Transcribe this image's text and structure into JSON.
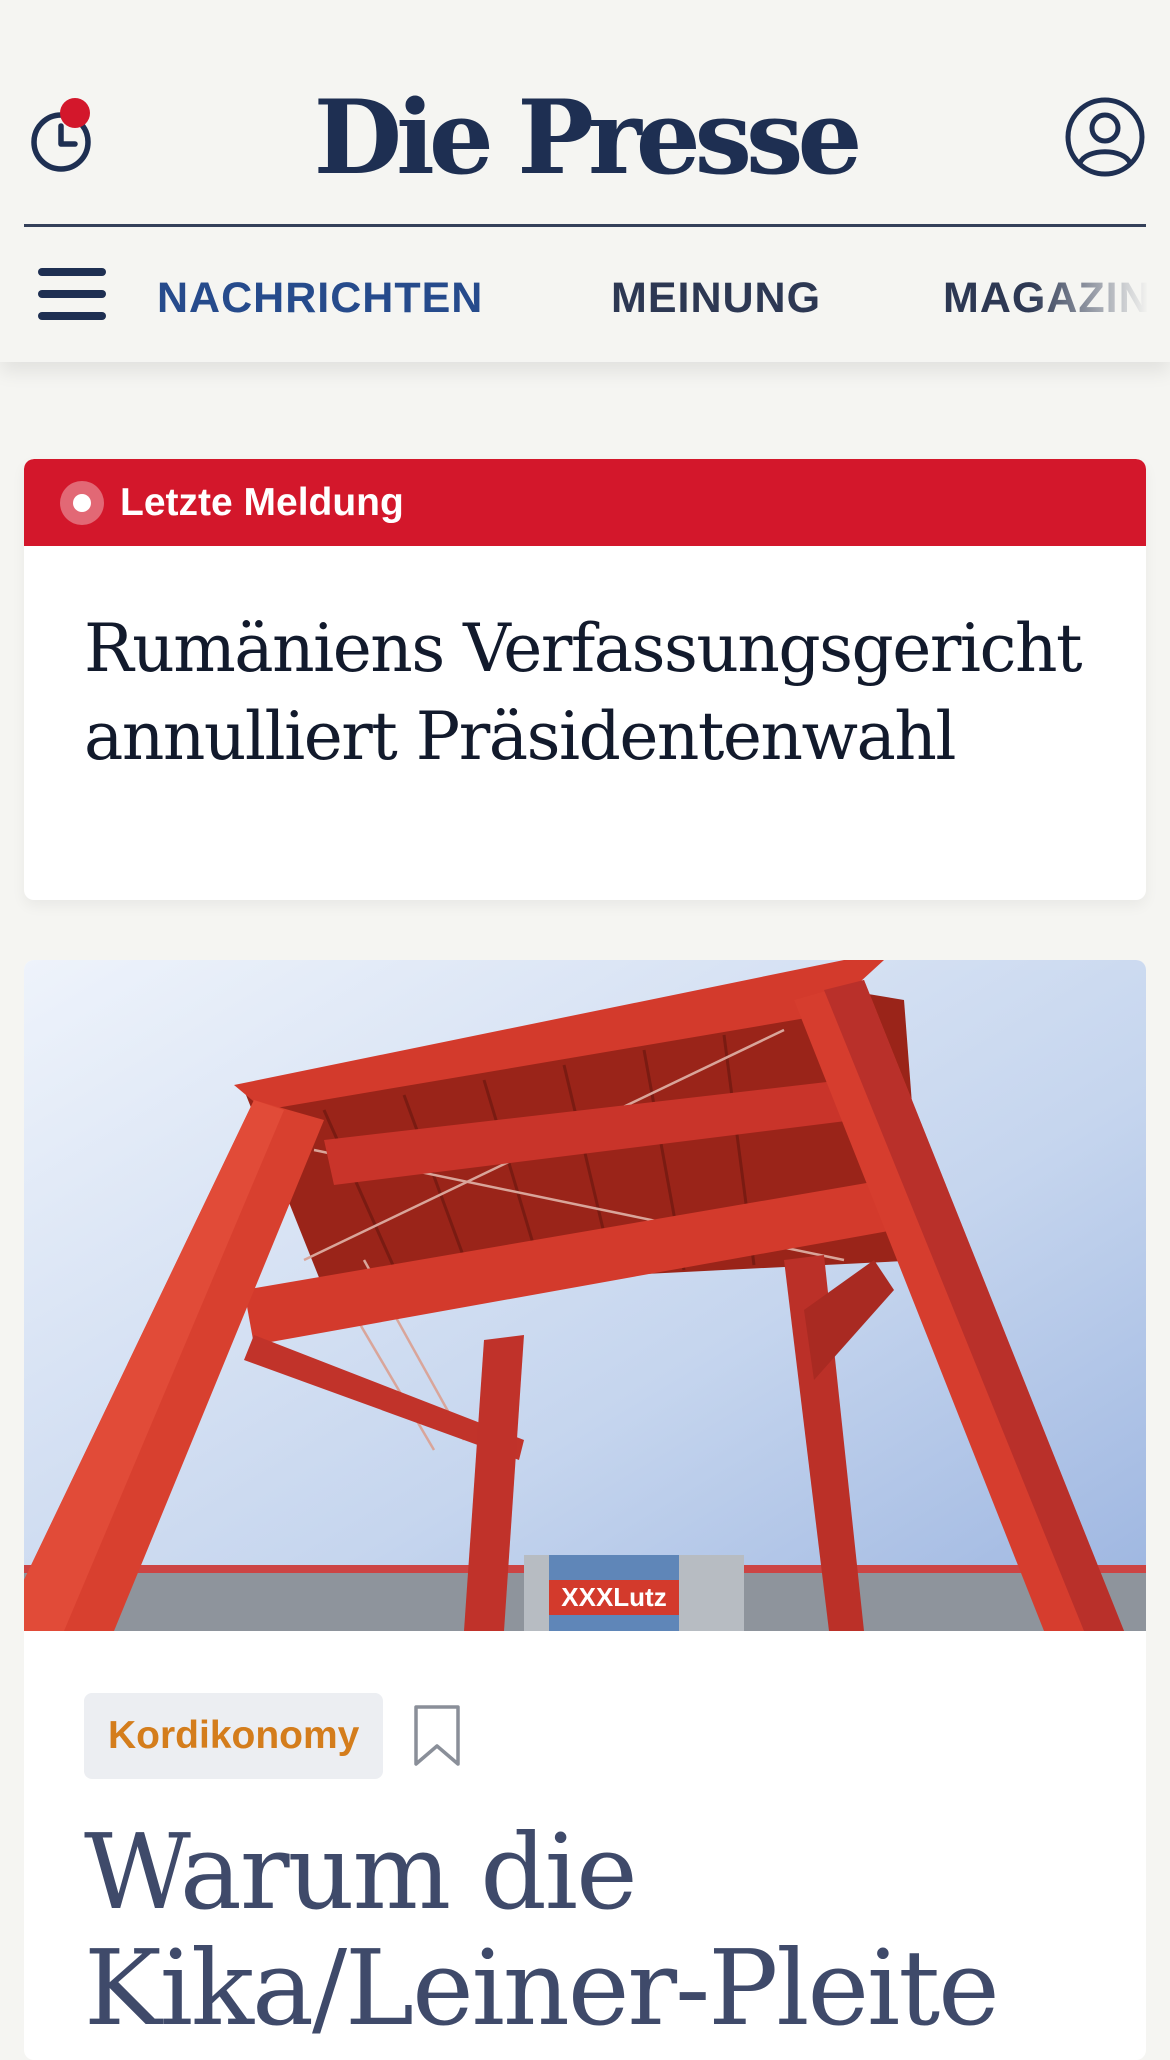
{
  "header": {
    "logo": "Die Presse",
    "nav": [
      "NACHRICHTEN",
      "MEINUNG",
      "MAGAZIN"
    ],
    "active_nav": "NACHRICHTEN",
    "icons": {
      "history": "clock-icon",
      "notification": "red-dot-badge",
      "user": "user-icon",
      "menu": "hamburger-icon"
    }
  },
  "breaking": {
    "label": "Letzte Meldung",
    "title_lines": [
      "Rumäniens Verfassungsgericht",
      "annulliert Präsidentenwahl"
    ]
  },
  "article": {
    "image_sign": "XXXLutz",
    "tag": "Kordikonomy",
    "title_lines": [
      "Warum die",
      "Kika/Leiner-Pleite"
    ]
  },
  "colors": {
    "brand": "#1e2f52",
    "nav_active": "#264b8c",
    "breaking": "#d3172b",
    "tag": "#d47d1c"
  }
}
